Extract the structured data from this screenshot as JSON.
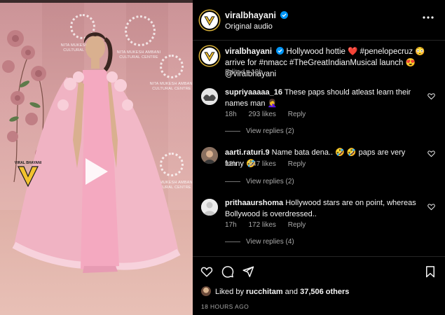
{
  "post": {
    "username": "viralbhayani",
    "audio": "Original audio"
  },
  "caption": {
    "username": "viralbhayani",
    "text": "Hollywood hottie ❤️ #penelopecruz 😳 arrive for #nmacc #TheGreatIndianMusical launch 😍 @viralbhayani",
    "meta": "Edited · 18h"
  },
  "comments": [
    {
      "username": "supriyaaaaa_16",
      "text": "These paps should atleast learn their names man 🤦‍♀️",
      "time": "18h",
      "likes": "293 likes",
      "reply": "Reply",
      "view_replies": "View replies (2)"
    },
    {
      "username": "aarti.raturi.9",
      "text": "Name bata dena.. 🤣 🤣 paps are very funny 🤣",
      "time": "18h",
      "likes": "547 likes",
      "reply": "Reply",
      "view_replies": "View replies (2)"
    },
    {
      "username": "prithaaurshoma",
      "text": "Hollywood stars are on point, whereas Bollywood is overdressed..",
      "time": "17h",
      "likes": "172 likes",
      "reply": "Reply",
      "view_replies": "View replies (4)"
    }
  ],
  "footer": {
    "liked_by_prefix": "Liked by ",
    "liked_by_user": "rucchitam",
    "liked_by_mid": " and ",
    "liked_by_count": "37,506 others",
    "timestamp": "18 HOURS AGO"
  },
  "media": {
    "backdrop_text_1": "NITA MUKESH AMBANI\nCULTURAL CENTRE",
    "watermark_text": "VIRAL BHAYANI"
  },
  "colors": {
    "background": "#000000",
    "text_primary": "#f5f5f5",
    "text_secondary": "#a8a8a8",
    "verified_blue": "#0095f6",
    "divider": "#262626"
  },
  "icons": [
    "verified-icon",
    "more-options-icon",
    "heart-icon",
    "comment-icon",
    "share-icon",
    "bookmark-icon",
    "play-icon"
  ]
}
